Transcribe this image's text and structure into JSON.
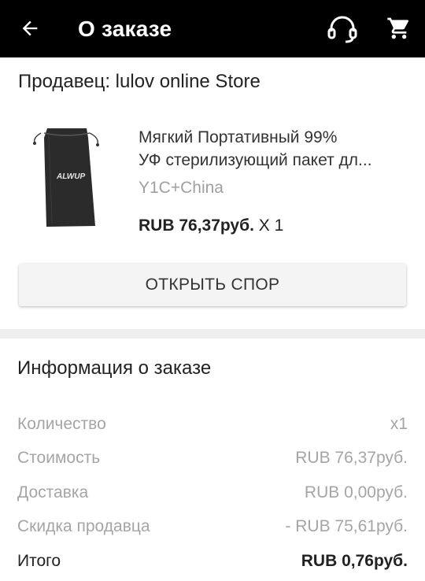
{
  "header": {
    "title": "О заказе"
  },
  "seller": {
    "label": "Продавец: lulov online Store"
  },
  "product": {
    "title_line1": "Мягкий Портативный 99%",
    "title_line2": "УФ стерилизующий пакет дл...",
    "variant": "Y1C+China",
    "price": "RUB 76,37руб.",
    "quantity": "X 1",
    "image_brand": "ALWUP"
  },
  "actions": {
    "dispute_label": "ОТКРЫТЬ СПОР"
  },
  "order_info": {
    "title": "Информация о заказе",
    "rows": [
      {
        "label": "Количество",
        "value": "x1"
      },
      {
        "label": "Стоимость",
        "value": "RUB 76,37руб."
      },
      {
        "label": "Доставка",
        "value": "RUB 0,00руб."
      },
      {
        "label": "Скидка продавца",
        "value": "- RUB 75,61руб."
      },
      {
        "label": "Итого",
        "value": "RUB 0,76руб."
      }
    ]
  },
  "colors": {
    "header_bg": "#000000",
    "header_text": "#ffffff",
    "muted_text": "#a5a5a5",
    "button_bg": "#f4f4f4",
    "divider": "#eeeeee"
  },
  "icons": [
    "back-arrow-icon",
    "headset-icon",
    "cart-icon"
  ]
}
